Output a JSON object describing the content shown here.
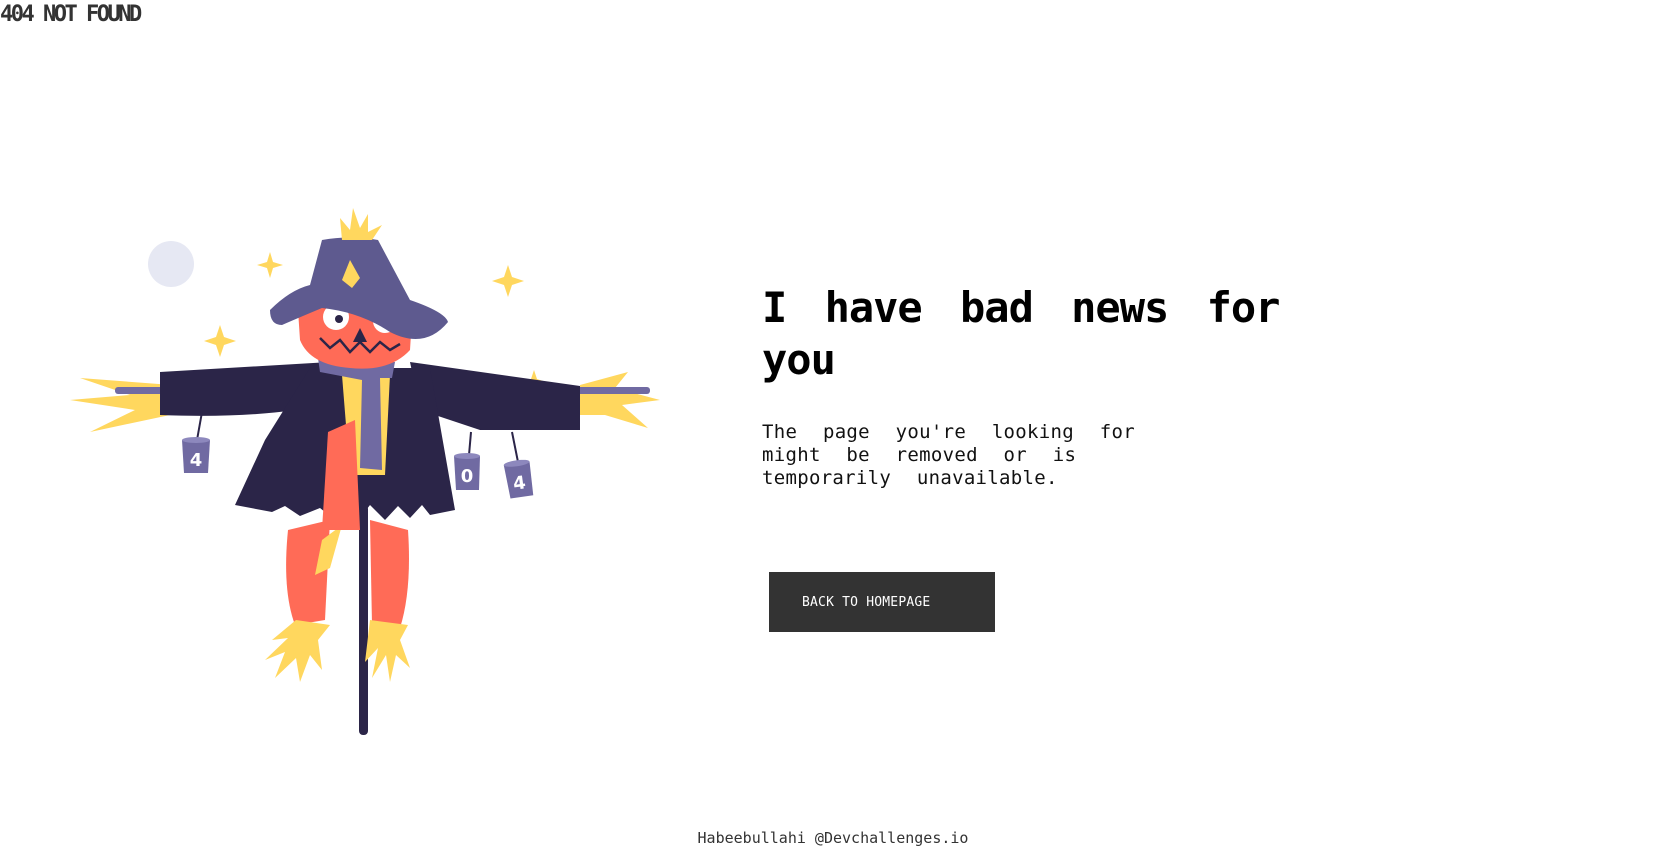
{
  "header": {
    "brand": "404 NOT FOUND"
  },
  "illustration": {
    "icon": "scarecrow-icon",
    "cans": [
      "4",
      "0",
      "4"
    ],
    "colors": {
      "hat": "#5e5a8f",
      "coat": "#2b2548",
      "face": "#ff6b57",
      "straw": "#ffd75e",
      "scarf": "#706aa2",
      "moon": "#e6e8f3"
    }
  },
  "main": {
    "headline": "I have bad news for you",
    "message": "The page you're looking for might be removed or is temporarily unavailable.",
    "button_label": "BACK TO HOMEPAGE"
  },
  "footer": {
    "credit": "Habeebullahi @Devchallenges.io"
  },
  "colors": {
    "button_bg": "#333333",
    "button_text": "#ffffff",
    "text": "#000000"
  }
}
